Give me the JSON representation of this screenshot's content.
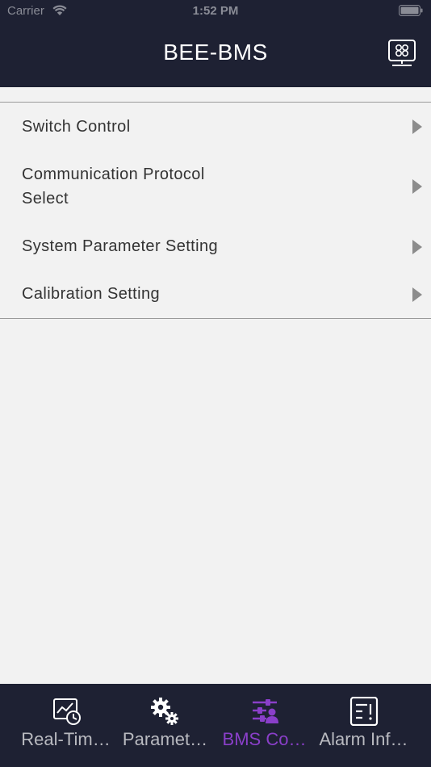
{
  "status_bar": {
    "carrier": "Carrier",
    "time": "1:52 PM"
  },
  "nav": {
    "title": "BEE-BMS",
    "right_icon": "device-monitor-icon"
  },
  "menu": {
    "items": [
      {
        "label": "Switch Control"
      },
      {
        "label": "Communication Protocol Select"
      },
      {
        "label": "System Parameter Setting"
      },
      {
        "label": "Calibration Setting"
      }
    ]
  },
  "tabbar": {
    "active_index": 2,
    "active_color": "#8a3fc9",
    "inactive_color": "#b9bac0",
    "tabs": [
      {
        "label": "Real-Tim…",
        "icon": "realtime-chart-clock-icon"
      },
      {
        "label": "Paramet…",
        "icon": "gears-icon"
      },
      {
        "label": "BMS Co…",
        "icon": "bms-control-sliders-icon"
      },
      {
        "label": "Alarm Inf…",
        "icon": "alarm-document-icon"
      }
    ]
  }
}
